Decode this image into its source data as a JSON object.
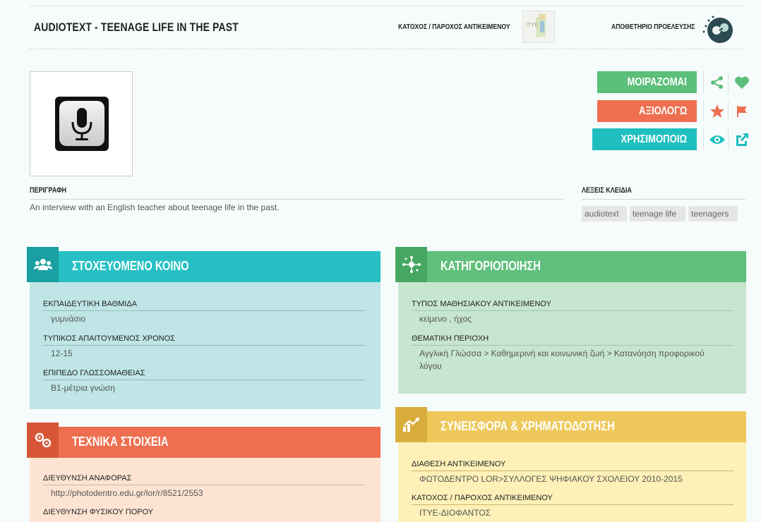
{
  "header": {
    "title": "AUDIOTEXT - TEENAGE LIFE IN THE PAST",
    "owner_label": "ΚΑΤΟΧΟΣ / ΠΑΡΟΧΟΣ ΑΝΤΙΚΕΙΜΕΝΟΥ",
    "repository_label": "ΑΠΟΘΕΤΗΡΙΟ ΠΡΟΕΛΕΥΣΗΣ",
    "owner_logo_text": "ΙΤΥΕ"
  },
  "actions": {
    "share_label": "ΜΟΙΡΑΖΟΜΑΙ",
    "rate_label": "ΑΞΙΟΛΟΓΩ",
    "use_label": "ΧΡΗΣΙΜΟΠΟΙΩ",
    "colors": {
      "share": "#5cbf7a",
      "rate": "#ee6f50",
      "use": "#1fbfbf"
    }
  },
  "description": {
    "label": "ΠΕΡΙΓΡΑΦΗ",
    "text": "An interview with an English teacher about teenage life in the past."
  },
  "keywords": {
    "label": "ΛΕΞΕΙΣ ΚΛΕΙΔΙΑ",
    "tags": [
      "audiotext",
      "teenage life",
      "teenagers"
    ]
  },
  "audience": {
    "title": "ΣΤΟΧΕΥΟΜΕΝΟ ΚΟΙΝΟ",
    "icon": "users-icon",
    "fields": [
      {
        "label": "ΕΚΠΑΙΔΕΥΤΙΚΗ ΒΑΘΜΙΔΑ",
        "value": "γυμνάσιο"
      },
      {
        "label": "ΤΥΠΙΚΟΣ ΑΠΑΙΤΟΥΜΕΝΟΣ ΧΡΟΝΟΣ",
        "value": "12-15"
      },
      {
        "label": "ΕΠΙΠΕΔΟ ΓΛΩΣΣΟΜΑΘΕΙΑΣ",
        "value": "Β1-μέτρια γνώση"
      }
    ]
  },
  "classification": {
    "title": "ΚΑΤΗΓΟΡΙΟΠΟΙΗΣΗ",
    "icon": "network-icon",
    "fields": [
      {
        "label": "ΤΥΠΟΣ ΜΑΘΗΣΙΑΚΟΥ ΑΝΤΙΚΕΙΜΕΝΟΥ",
        "value": "κείμενο , ήχος"
      },
      {
        "label": "ΘΕΜΑΤΙΚΗ ΠΕΡΙΟΧΗ",
        "value": "Αγγλική Γλώσσα > Καθημερινή και κοινωνική ζωή > Κατανόηση προφορικού λόγου"
      }
    ]
  },
  "technical": {
    "title": "ΤΕΧΝΙΚΑ ΣΤΟΙΧΕΙΑ",
    "icon": "gears-icon",
    "fields": [
      {
        "label": "ΔΙΕΥΘΥΝΣΗ ΑΝΑΦΟΡΑΣ",
        "value": "http://photodentro.edu.gr/lor/r/8521/2553"
      },
      {
        "label": "ΔΙΕΥΘΥΝΣΗ ΦΥΣΙΚΟΥ ΠΟΡΟΥ",
        "value": ""
      }
    ]
  },
  "contribution": {
    "title": "ΣΥΝΕΙΣΦΟΡΑ & ΧΡΗΜΑΤΟΔΟΤΗΣΗ",
    "icon": "chart-trend-icon",
    "fields": [
      {
        "label": "ΔΙΑΘΕΣΗ ΑΝΤΙΚΕΙΜΕΝΟΥ",
        "value": "ΦΩΤΟΔΕΝΤΡΟ LOR>ΣΥΛΛΟΓΕΣ ΨΗΦΙΑΚΟΥ ΣΧΟΛΕΙΟΥ 2010-2015"
      },
      {
        "label": "ΚΑΤΟΧΟΣ / ΠΑΡΟΧΟΣ ΑΝΤΙΚΕΙΜΕΝΟΥ",
        "value": "ΙΤΥΕ-ΔΙΟΦΑΝΤΟΣ"
      }
    ]
  }
}
